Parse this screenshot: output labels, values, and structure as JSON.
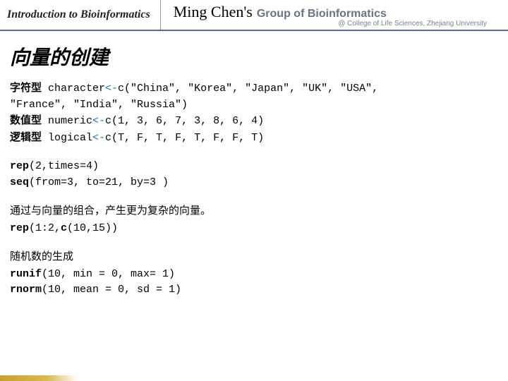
{
  "header": {
    "course_title": "Introduction to Bioinformatics",
    "brand_name": "Ming Chen's",
    "brand_group": "Group of Bioinformatics",
    "brand_sub": "@ College of Life Sciences, Zhejiang University"
  },
  "title": "向量的创建",
  "vector_types": {
    "char_label": "字符型",
    "char_code1": " character",
    "char_op1": "<-",
    "char_code2": "c(\"China\", \"Korea\", \"Japan\", \"UK\", \"USA\",",
    "char_code3": "\"France\", \"India\", \"Russia\")",
    "num_label": "数值型",
    "num_code1": " numeric",
    "num_op": "<-",
    "num_code2": "c(1, 3, 6, 7, 3, 8, 6, 4)",
    "log_label": "逻辑型",
    "log_code1": " logical",
    "log_op": "<-",
    "log_code2": "c(T, F, T, F, T, F, F, T)"
  },
  "rep_seq": {
    "rep_fn": "rep",
    "rep_args": "(2,times=4)",
    "seq_fn": "seq",
    "seq_args": "(from=3, to=21, by=3 )"
  },
  "combine": {
    "desc": "通过与向量的组合，产生更为复杂的向量。",
    "rep_fn": "rep",
    "rep_args1": "(1:2,",
    "c_fn": "c",
    "rep_args2": "(10,15))"
  },
  "random": {
    "desc": "随机数的生成",
    "runif_fn": "runif",
    "runif_args": "(10, min = 0, max= 1)",
    "rnorm_fn": "rnorm",
    "rnorm_args": "(10, mean = 0, sd = 1)"
  }
}
